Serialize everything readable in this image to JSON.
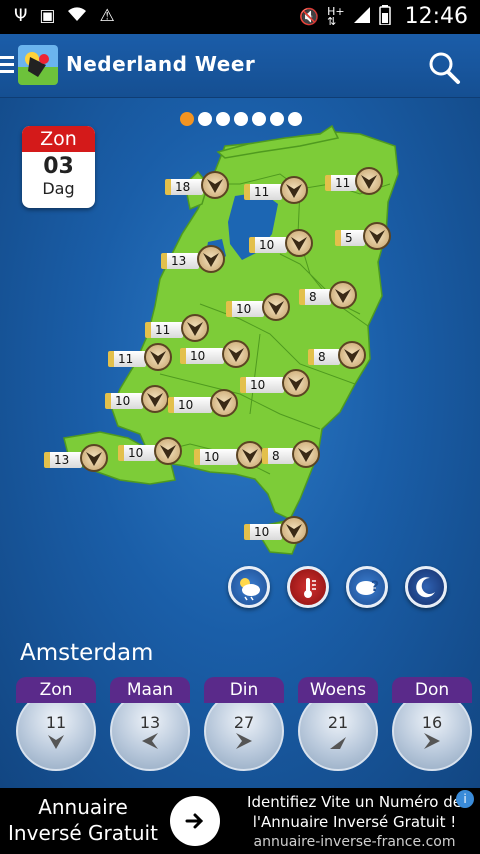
{
  "status_bar": {
    "icons": [
      "usb-icon",
      "image-icon",
      "wifi-icon",
      "warning-icon",
      "mute-icon",
      "h-plus-icon",
      "signal-icon",
      "battery-icon"
    ],
    "time": "12:46"
  },
  "app": {
    "title": "Nederland Weer",
    "page_dots": 7,
    "active_dot": 0
  },
  "calendar": {
    "day": "Zon",
    "date": "03",
    "label": "Dag"
  },
  "map_markers": [
    {
      "value": "18"
    },
    {
      "value": "11"
    },
    {
      "value": "11"
    },
    {
      "value": "10"
    },
    {
      "value": "5"
    },
    {
      "value": "13"
    },
    {
      "value": "10"
    },
    {
      "value": "8"
    },
    {
      "value": "11"
    },
    {
      "value": "11"
    },
    {
      "value": "10"
    },
    {
      "value": "8"
    },
    {
      "value": "10"
    },
    {
      "value": "10"
    },
    {
      "value": "10"
    },
    {
      "value": "13"
    },
    {
      "value": "10"
    },
    {
      "value": "10"
    },
    {
      "value": "8"
    },
    {
      "value": "10"
    }
  ],
  "weather_buttons": [
    "cloud-sun-icon",
    "temperature-icon",
    "question-cloud-icon",
    "moon-icon"
  ],
  "city": "Amsterdam",
  "forecast": [
    {
      "day": "Zon",
      "temp": "11"
    },
    {
      "day": "Maan",
      "temp": "13"
    },
    {
      "day": "Din",
      "temp": "27"
    },
    {
      "day": "Woens",
      "temp": "21"
    },
    {
      "day": "Don",
      "temp": "16"
    }
  ],
  "ad": {
    "left_text": "Annuaire Inversé Gratuit",
    "headline_line1": "Identifiez Vite un Numéro de",
    "headline_line2": "l'Annuaire Inversé Gratuit !",
    "url": "annuaire-inverse-france.com"
  },
  "colors": {
    "background": "#1a5ea8",
    "land": "#7dcc38",
    "tab": "#5a2a8a",
    "active_dot": "#f29422",
    "calendar_red": "#d41a1a"
  }
}
